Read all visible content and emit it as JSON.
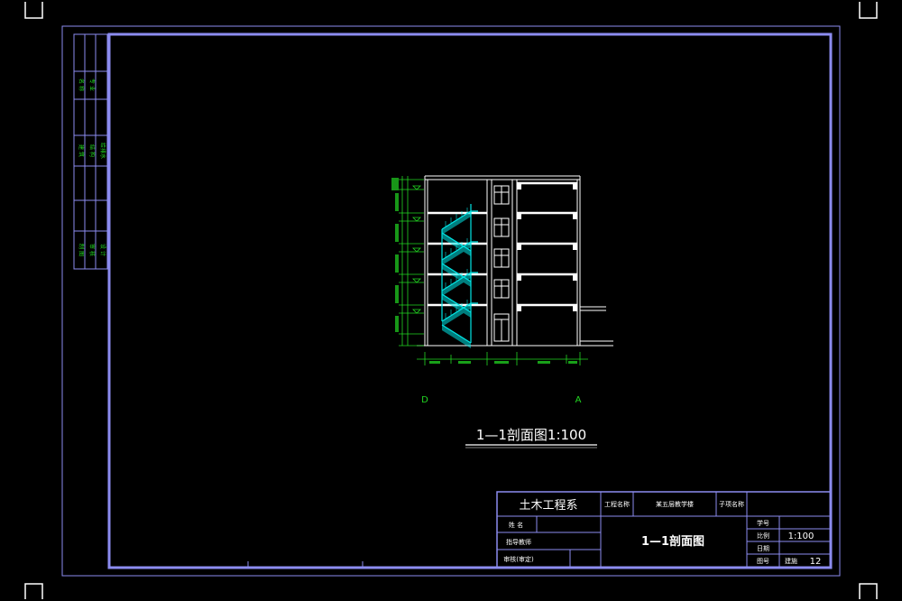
{
  "drawing": {
    "section_title": "1—1剖面图1:100",
    "axis_left": "D",
    "axis_right": "A",
    "colors": {
      "frame": "#8c8cf0",
      "text": "#ffffff",
      "dims": "#22d622",
      "stairs": "#00e5e5"
    }
  },
  "side_strip": {
    "labels": [
      "专 业",
      "名 称",
      "建 筑",
      "结 构",
      "给排水",
      "设 计",
      "制 图",
      "审 核"
    ]
  },
  "title_block": {
    "department": "土木工程系",
    "project_label": "工程名称",
    "project_name": "某五层教学楼",
    "subitem_label": "子项名称",
    "name_label": "姓    名",
    "advisor_label": "指导教师",
    "reviewer_label": "审核(审定)",
    "drawing_title": "1—1剖面图",
    "number_label": "学号",
    "scale_label": "比例",
    "scale_value": "1:100",
    "date_label": "日期",
    "sheet_label": "图号",
    "sheet_type": "建施",
    "sheet_number": "12"
  }
}
